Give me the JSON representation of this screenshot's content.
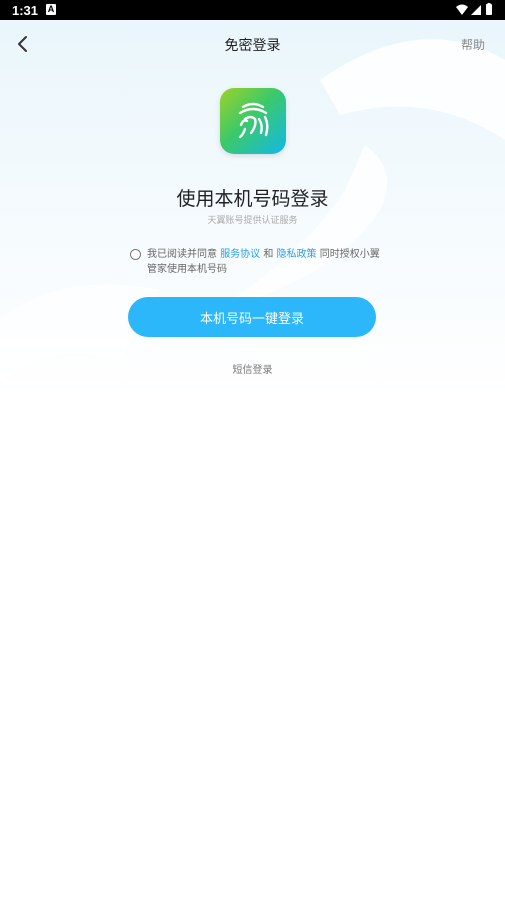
{
  "status_bar": {
    "time": "1:31",
    "notification_badge": "A"
  },
  "nav": {
    "title": "免密登录",
    "help_label": "帮助"
  },
  "logo": {
    "icon": "fingerprint-app-icon",
    "gradient_colors": [
      "#9bd427",
      "#3cc96a",
      "#12b8e8"
    ]
  },
  "main": {
    "title": "使用本机号码登录",
    "subtitle": "天翼账号提供认证服务"
  },
  "agreement": {
    "checked": false,
    "prefix": "我已阅读并同意 ",
    "service_link": "服务协议",
    "and": " 和 ",
    "privacy_link": "隐私政策",
    "suffix": " 同时授权小翼管家使用本机号码"
  },
  "actions": {
    "one_click_login_label": "本机号码一键登录",
    "sms_login_label": "短信登录"
  },
  "colors": {
    "primary_button": "#2cb7fb",
    "link": "#2a9df4"
  }
}
